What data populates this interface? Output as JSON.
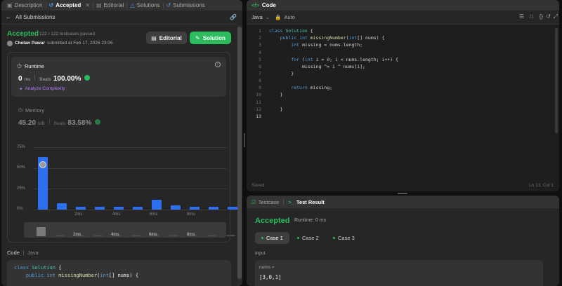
{
  "left_tabs": [
    {
      "label": "Description",
      "icon": "document-icon"
    },
    {
      "label": "Accepted",
      "icon": "history-icon",
      "active": true
    },
    {
      "label": "Editorial",
      "icon": "book-icon"
    },
    {
      "label": "Solutions",
      "icon": "flask-icon"
    },
    {
      "label": "Submissions",
      "icon": "history-icon"
    }
  ],
  "back_label": "All Submissions",
  "result": {
    "status": "Accepted",
    "testcases": "122 / 122 testcases passed",
    "user": "Chetan Pawar",
    "submitted": "submitted at Feb 17, 2025 23:05",
    "editorial_btn": "Editorial",
    "solution_btn": "Solution"
  },
  "runtime": {
    "title": "Runtime",
    "value": "0",
    "unit": "ms",
    "beats_label": "Beats",
    "beats_value": "100.00%",
    "analyze": "Analyze Complexity"
  },
  "memory": {
    "title": "Memory",
    "value": "45.20",
    "unit": "MB",
    "beats_label": "Beats",
    "beats_value": "83.58%"
  },
  "chart_data": {
    "type": "bar",
    "y_ticks": [
      "75%",
      "50%",
      "25%",
      "0%"
    ],
    "x_ticks": [
      "2ms",
      "4ms",
      "6ms",
      "8ms"
    ],
    "ylim": [
      0,
      75
    ],
    "values": [
      63,
      8,
      3,
      3,
      3,
      3,
      12,
      5,
      3,
      3,
      3
    ],
    "mini_x_ticks": [
      "2ms",
      "4ms",
      "6ms",
      "8ms"
    ],
    "accent": "#2c6ff0"
  },
  "bottom_code": {
    "header": "Code",
    "lang": "Java",
    "lines": [
      "class Solution {",
      "    public int missingNumber(int[] nums) {"
    ]
  },
  "editor": {
    "title": "Code",
    "language": "Java",
    "mode": "Auto",
    "status": "Saved",
    "cursor": "Ln 13, Col 1",
    "line_numbers": [
      "1",
      "2",
      "3",
      "4",
      "5",
      "6",
      "7",
      "8",
      "9",
      "10",
      "11",
      "12",
      "13"
    ]
  },
  "test_panel": {
    "tab_testcase": "Testcase",
    "tab_result": "Test Result",
    "status": "Accepted",
    "runtime": "Runtime: 0 ms",
    "cases": [
      "Case 1",
      "Case 2",
      "Case 3"
    ],
    "input_label": "Input",
    "param_name": "nums =",
    "param_value": "[3,0,1]"
  },
  "colors": {
    "accent_green": "#2cbb5d",
    "accent_blue": "#2c6ff0",
    "panel": "#262626"
  }
}
